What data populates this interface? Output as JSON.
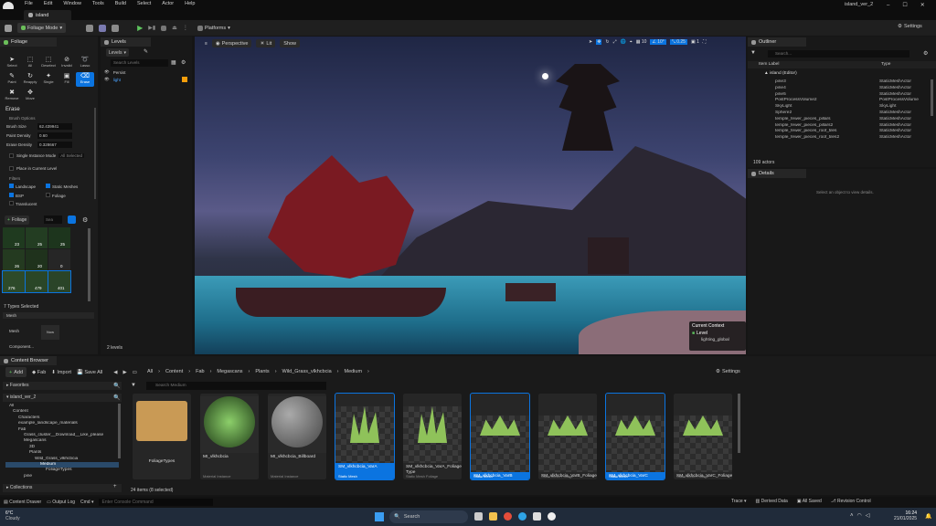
{
  "menubar": {
    "items": [
      "File",
      "Edit",
      "Window",
      "Tools",
      "Build",
      "Select",
      "Actor",
      "Help"
    ],
    "project": "island_ver_2"
  },
  "tab": {
    "title": "island"
  },
  "toolbar": {
    "mode": "Foliage Mode",
    "platforms": "Platforms",
    "settings": "Settings"
  },
  "foliage": {
    "panel_title": "Foliage",
    "tools": [
      "Select",
      "All",
      "Deselect",
      "Invalid",
      "Lasso",
      "Paint",
      "Reapply",
      "Single",
      "Fill",
      "Erase",
      "Remove",
      "Move"
    ],
    "section": "Erase",
    "brush_options": "Brush Options",
    "brush_size_label": "Brush Size",
    "brush_size": "62.439941",
    "paint_density_label": "Paint Density",
    "paint_density": "0.60",
    "erase_density_label": "Erase Density",
    "erase_density": "0.328667",
    "single_instance": "Single Instance Mode",
    "single_instance_value": "All Selected",
    "place_current_level": "Place in Current Level",
    "filters": "Filters",
    "filter_items": [
      "Landscape",
      "Static Meshes",
      "BSP",
      "Foliage",
      "Translucent"
    ],
    "add_foliage": "Foliage",
    "search_placeholder": "Sea",
    "thumb_counts": [
      "23",
      "25",
      "25",
      "26",
      "20",
      "0",
      "276",
      "479",
      "401"
    ],
    "types_selected": "7 Types Selected",
    "mesh_section": "Mesh",
    "mesh_label": "Mesh",
    "mesh_value": "Now",
    "component_label": "Component..."
  },
  "levels": {
    "panel_title": "Levels",
    "button": "Levels",
    "search_placeholder": "Search Levels",
    "rows": [
      "Persist",
      "light"
    ],
    "footer": "2 levels"
  },
  "viewport": {
    "perspective": "Perspective",
    "lit": "Lit",
    "show": "Show",
    "grid": "10",
    "angle": "10°",
    "scale": "0.25",
    "speed": "1",
    "context_title": "Current Context",
    "context_level": "Level",
    "context_value": "lighting_global"
  },
  "outliner": {
    "panel_title": "Outliner",
    "search_placeholder": "Search...",
    "col_label": "Item Label",
    "col_type": "Type",
    "root": "island (Editor)",
    "rows": [
      [
        "pine3",
        "StaticMeshActor"
      ],
      [
        "pine4",
        "StaticMeshActor"
      ],
      [
        "pine5",
        "StaticMeshActor"
      ],
      [
        "PostProcessVolume2",
        "PostProcessVolume"
      ],
      [
        "SkyLight",
        "SkyLight"
      ],
      [
        "Sphere2",
        "StaticMeshActor"
      ],
      [
        "temple_fewer_pieces_pillars",
        "StaticMeshActor"
      ],
      [
        "temple_fewer_pieces_pillars2",
        "StaticMeshActor"
      ],
      [
        "temple_fewer_pieces_roof_tiles",
        "StaticMeshActor"
      ],
      [
        "temple_fewer_pieces_roof_tiles2",
        "StaticMeshActor"
      ]
    ],
    "count": "109 actors"
  },
  "details": {
    "panel_title": "Details",
    "empty": "Select an object to view details."
  },
  "content_browser": {
    "panel_title": "Content Browser",
    "add": "Add",
    "fab": "Fab",
    "import": "Import",
    "save_all": "Save All",
    "breadcrumb": [
      "All",
      "Content",
      "Fab",
      "Megascans",
      "Plants",
      "Wild_Grass_vlkhcbcia",
      "Medium"
    ],
    "settings": "Settings",
    "favorites": "Favorites",
    "project": "island_ver_2",
    "search_placeholder": "Search Medium",
    "tree": [
      "All",
      "Content",
      "Characters",
      "example_landscape_materials",
      "Fab",
      "Grass_cluster__Download__Like_please",
      "Megascans",
      "3D",
      "Plants",
      "Wild_Grass_vlkhcbcia",
      "Medium",
      "FoliageTypes",
      "pine"
    ],
    "collections": "Collections",
    "status": "24 items (8 selected)",
    "assets": [
      {
        "name": "FoliageTypes",
        "type": ""
      },
      {
        "name": "MI_vlkhcbcia",
        "type": "Material Instance"
      },
      {
        "name": "MI_vlkhcbcia_Billboard",
        "type": "Material Instance"
      },
      {
        "name": "SM_vlkhcbcia_VarA",
        "type": "Static Mesh"
      },
      {
        "name": "SM_vlkhcbcia_VarA_Foliage Type",
        "type": "Static Mesh Foliage"
      },
      {
        "name": "SM_vlkhcbcia_VarB",
        "type": "Static Mesh"
      },
      {
        "name": "SM_vlkhcbcia_VarB_Foliage Type",
        "type": "Static Mesh Foliage"
      },
      {
        "name": "SM_vlkhcbcia_VarC",
        "type": "Static Mesh"
      },
      {
        "name": "SM_vlkhcbcia_VarC_Foliage Type",
        "type": "Static Mesh Foliage"
      }
    ]
  },
  "statusbar": {
    "drawer": "Content Drawer",
    "output": "Output Log",
    "cmd": "Cmd",
    "console_placeholder": "Enter Console Command",
    "trace": "Trace",
    "derived": "Derived Data",
    "saved": "All Saved",
    "revision": "Revision Control"
  },
  "taskbar": {
    "temp": "6°C",
    "weather": "Cloudy",
    "search": "Search",
    "time": "16:24",
    "date": "21/01/2025"
  }
}
